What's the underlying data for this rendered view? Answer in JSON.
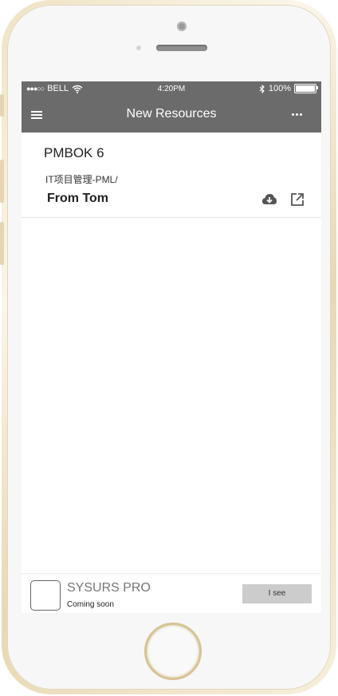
{
  "status_bar": {
    "signal": "●●●○○",
    "carrier": "BELL",
    "time": "4:20PM",
    "battery": "100%",
    "battery_level": 1.0
  },
  "nav": {
    "title": "New Resources",
    "menu_icon": "hamburger-icon",
    "more_icon": "ellipsis-icon"
  },
  "resource": {
    "title": "PMBOK 6",
    "path": "IT项目管理-PML/",
    "from": "From Tom",
    "download_icon": "cloud-download-icon",
    "open_icon": "external-link-icon"
  },
  "footer": {
    "title": "SYSURS PRO",
    "subtitle": "Coming soon",
    "button_label": "I see"
  },
  "colors": {
    "header_bg": "#6b6b6b",
    "header_text": "#ffffff",
    "button_bg": "#cccccc",
    "phone_gold": "#e8d8b2"
  }
}
